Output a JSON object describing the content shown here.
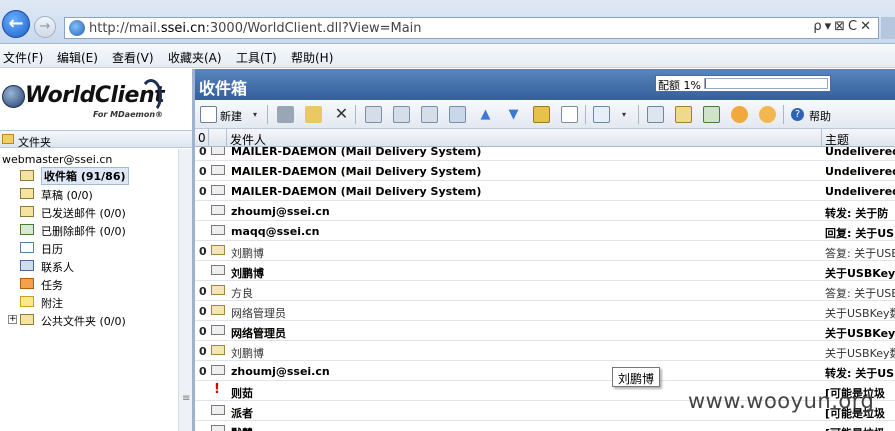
{
  "browser": {
    "back_label": "←",
    "forward_label": "→",
    "url_prefix": "http://mail.",
    "url_domain": "ssei.cn",
    "url_suffix": ":3000/WorldClient.dll?View=Main",
    "url_tools": "ρ▾⊠C✕"
  },
  "menu": {
    "file": "文件(F)",
    "edit": "编辑(E)",
    "view": "查看(V)",
    "favorites": "收藏夹(A)",
    "tools": "工具(T)",
    "help": "帮助(H)"
  },
  "logo": {
    "title": "WorldClient",
    "subtitle": "For MDaemon®"
  },
  "sidebar": {
    "header": "文件夹",
    "account": "webmaster@ssei.cn",
    "items": [
      {
        "label": "收件箱 (91/86)",
        "icon": "inbox-icon",
        "selected": true
      },
      {
        "label": "草稿 (0/0)",
        "icon": "drafts-icon"
      },
      {
        "label": "已发送邮件 (0/0)",
        "icon": "sent-icon"
      },
      {
        "label": "已删除邮件 (0/0)",
        "icon": "trash-icon"
      },
      {
        "label": "日历",
        "icon": "calendar-icon"
      },
      {
        "label": "联系人",
        "icon": "contacts-icon"
      },
      {
        "label": "任务",
        "icon": "tasks-icon"
      },
      {
        "label": "附注",
        "icon": "notes-icon"
      },
      {
        "label": "公共文件夹 (0/0)",
        "icon": "public-folder-icon"
      }
    ],
    "expand_label": "+",
    "scroll_grip": "≡"
  },
  "inbox": {
    "title": "收件箱",
    "quota_label": "配额 1%",
    "quota_percent": 1
  },
  "toolbar": {
    "new_label": "新建",
    "help_label": "帮助",
    "dropdown_glyph": "▾"
  },
  "columns": {
    "attach": "0",
    "from": "发件人",
    "subject": "主题"
  },
  "messages": [
    {
      "attach": "0",
      "status": "unread",
      "from": "MAILER-DAEMON (Mail Delivery System)",
      "subject": "Undelivered",
      "bold": true
    },
    {
      "attach": "0",
      "status": "unread",
      "from": "MAILER-DAEMON (Mail Delivery System)",
      "subject": "Undelivered",
      "bold": true
    },
    {
      "attach": "0",
      "status": "unread",
      "from": "MAILER-DAEMON (Mail Delivery System)",
      "subject": "Undelivered",
      "bold": true
    },
    {
      "attach": "",
      "status": "unread",
      "from": "zhoumj@ssei.cn",
      "subject": "转发: 关于防",
      "bold": true
    },
    {
      "attach": "",
      "status": "unread",
      "from": "maqq@ssei.cn",
      "subject": "回复: 关于US",
      "bold": true
    },
    {
      "attach": "0",
      "status": "read",
      "from": "刘鹏博",
      "subject": "答复: 关于USB",
      "bold": false
    },
    {
      "attach": "",
      "status": "unread",
      "from": "刘鹏博",
      "subject": "关于USBKey",
      "bold": true
    },
    {
      "attach": "0",
      "status": "read",
      "from": "方良",
      "subject": "答复: 关于USB",
      "bold": false
    },
    {
      "attach": "0",
      "status": "read",
      "from": "网络管理员",
      "subject": "关于USBKey数",
      "bold": false
    },
    {
      "attach": "0",
      "status": "unread",
      "from": "网络管理员",
      "subject": "关于USBKey",
      "bold": true
    },
    {
      "attach": "0",
      "status": "read",
      "from": "刘鹏博",
      "subject": "关于USBKey数",
      "bold": false
    },
    {
      "attach": "0",
      "status": "unread",
      "from": "zhoumj@ssei.cn",
      "subject": "转发: 关于US",
      "bold": true
    },
    {
      "attach": "",
      "status": "urgent",
      "from": "则茹",
      "subject": "[可能是垃圾",
      "bold": true
    },
    {
      "attach": "",
      "status": "unread",
      "from": "派者",
      "subject": "[可能是垃圾",
      "bold": true
    },
    {
      "attach": "",
      "status": "unread",
      "from": "默慧",
      "subject": "[可能是垃圾",
      "bold": true
    }
  ],
  "urgent_glyph": "!",
  "tooltip": "刘鹏博",
  "watermark": "www.wooyun.org"
}
